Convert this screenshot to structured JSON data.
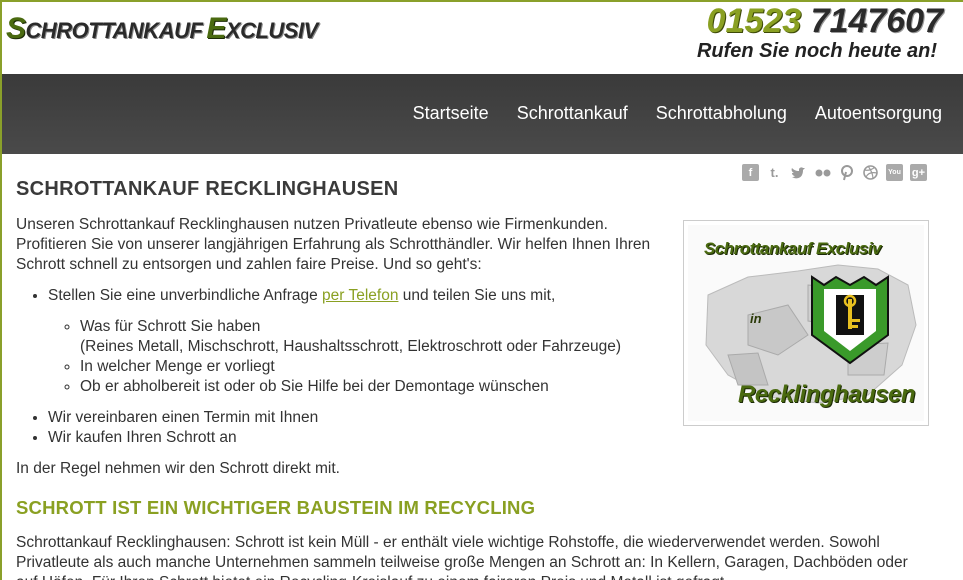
{
  "header": {
    "logo_first_letter": "S",
    "logo_word1": "CHROTTANKAUF",
    "logo_second_letter": "E",
    "logo_word2": "XCLUSIV",
    "phone_prefix": "01523",
    "phone_number": "7147607",
    "cta": "Rufen Sie noch heute an!"
  },
  "nav": {
    "items": [
      {
        "label": "Startseite"
      },
      {
        "label": "Schrottankauf"
      },
      {
        "label": "Schrottabholung"
      },
      {
        "label": "Autoentsorgung"
      }
    ]
  },
  "social": {
    "icons": [
      "facebook-icon",
      "tumblr-icon",
      "twitter-icon",
      "flickr-icon",
      "pinterest-icon",
      "dribbble-icon",
      "youtube-icon",
      "googleplus-icon"
    ],
    "glyphs": [
      "f",
      "t.",
      "🐦",
      "••",
      "℗",
      "◎",
      "You",
      "g+"
    ]
  },
  "main": {
    "title": "SCHROTTANKAUF RECKLINGHAUSEN",
    "intro": "Unseren Schrottankauf Recklinghausen nutzen Privatleute ebenso wie Firmenkunden. Profitieren Sie von unserer langjährigen Erfahrung als Schrotthändler. Wir helfen Ihnen Ihren Schrott schnell zu entsorgen und zahlen faire Preise. Und so geht's:",
    "step1_before": "Stellen Sie eine unverbindliche Anfrage ",
    "step1_link": "per Telefon",
    "step1_after": " und teilen Sie uns mit,",
    "sub1_line1": "Was für Schrott Sie haben",
    "sub1_line2": "(Reines Metall, Mischschrott, Haushaltsschrott, Elektroschrott oder Fahrzeuge)",
    "sub2": "In welcher Menge er vorliegt",
    "sub3": "Ob er abholbereit ist oder ob Sie Hilfe bei der Demontage wünschen",
    "step2": "Wir vereinbaren einen Termin mit Ihnen",
    "step3": "Wir kaufen Ihren Schrott an",
    "closing": "In der Regel nehmen wir den Schrott direkt mit.",
    "subtitle": "SCHROTT IST EIN WICHTIGER BAUSTEIN IM RECYCLING",
    "body2": "Schrottankauf Recklinghausen: Schrott ist kein Müll - er enthält viele wichtige Rohstoffe, die wiederverwendet werden. Sowohl Privatleute als auch manche Unternehmen sammeln teilweise große Mengen an Schrott an: In Kellern, Garagen, Dachböden oder auf Höfen. Für Ihren Schrott bietet ein Recycling-Kreislauf zu einem faireren Preis und Metall ist gefragt."
  },
  "image": {
    "title": "Schrottankauf Exclusiv",
    "in": "in",
    "city": "Recklinghausen",
    "coat_colors": {
      "green": "#3a9a2a",
      "white": "#ffffff",
      "black": "#111111",
      "key": "#e8c020"
    }
  },
  "colors": {
    "accent": "#8aa022",
    "nav_bg": "#3f3f3f",
    "text": "#333333"
  }
}
